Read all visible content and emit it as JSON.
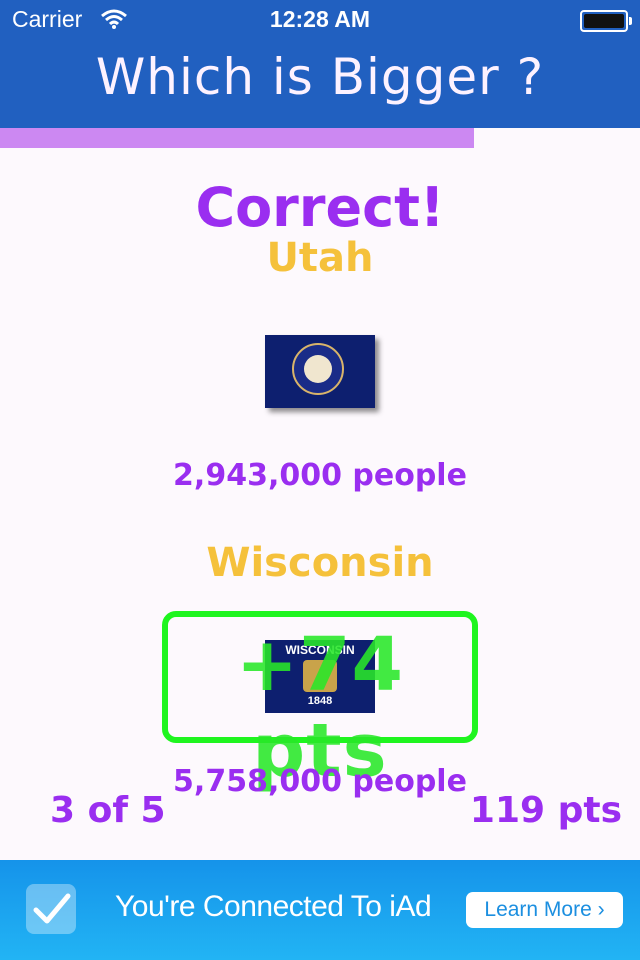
{
  "status_bar": {
    "carrier": "Carrier",
    "time": "12:28 AM"
  },
  "app": {
    "title": "Which is Bigger ?"
  },
  "progress": {
    "fraction": 0.74
  },
  "result": {
    "message": "Correct!"
  },
  "state_a": {
    "name": "Utah",
    "population": "2,943,000 people"
  },
  "state_b": {
    "name": "Wisconsin",
    "population": "5,758,000 people",
    "flag_text": "WISCONSIN",
    "flag_year": "1848"
  },
  "points_awarded": "+74 pts",
  "footer": {
    "question_counter": "3 of 5",
    "total_score": "119 pts"
  },
  "ad": {
    "message": "You're Connected To iAd",
    "button_label": "Learn More ›"
  },
  "colors": {
    "header": "#2160c0",
    "accent_purple": "#9a2ef0",
    "state_gold": "#f5c13b",
    "points_green": "#1ff51f",
    "progress": "#cc88f2",
    "ad_blue": "#1593ea"
  }
}
